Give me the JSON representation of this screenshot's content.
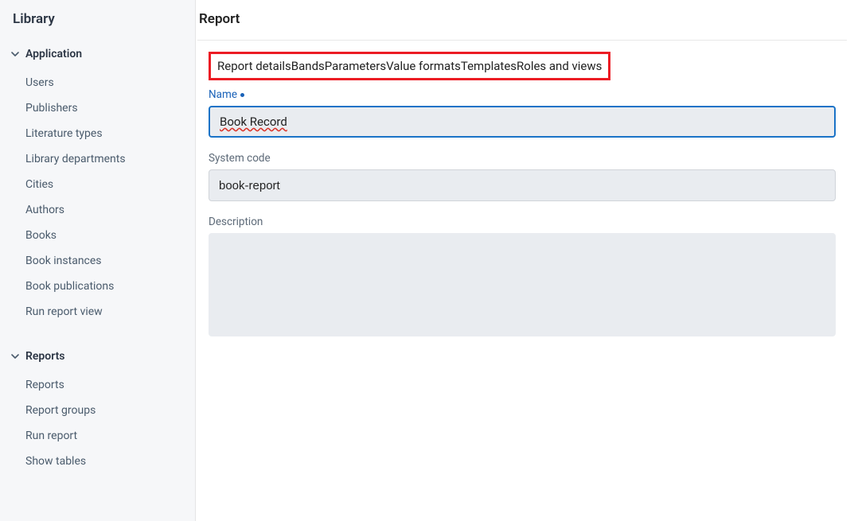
{
  "sidebar": {
    "title": "Library",
    "sections": [
      {
        "label": "Application",
        "items": [
          "Users",
          "Publishers",
          "Literature types",
          "Library departments",
          "Cities",
          "Authors",
          "Books",
          "Book instances",
          "Book publications",
          "Run report view"
        ]
      },
      {
        "label": "Reports",
        "items": [
          "Reports",
          "Report groups",
          "Run report",
          "Show tables"
        ]
      }
    ]
  },
  "main": {
    "title": "Report",
    "tabs": [
      "Report details",
      "Bands",
      "Parameters",
      "Value formats",
      "Templates",
      "Roles and views"
    ],
    "fields": {
      "name": {
        "label": "Name",
        "value": "Book Record",
        "required": true
      },
      "system_code": {
        "label": "System code",
        "value": "book-report",
        "required": false
      },
      "description": {
        "label": "Description",
        "value": "",
        "required": false
      }
    }
  }
}
